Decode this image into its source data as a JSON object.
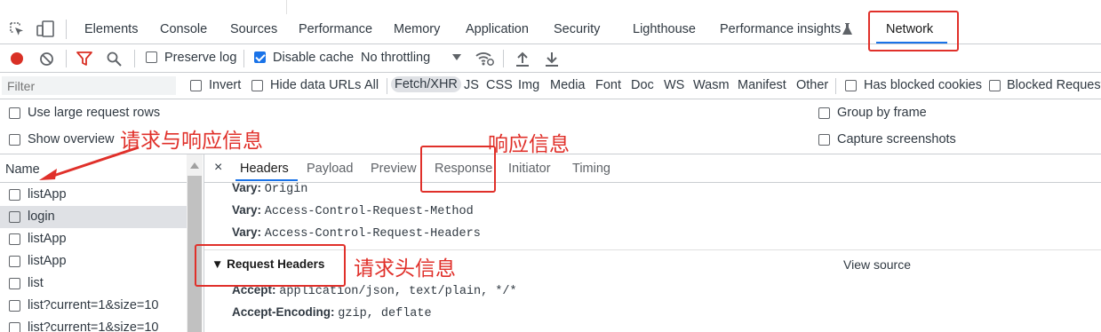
{
  "devtools": {
    "tabs": [
      {
        "label": "Elements"
      },
      {
        "label": "Console"
      },
      {
        "label": "Sources"
      },
      {
        "label": "Performance"
      },
      {
        "label": "Memory"
      },
      {
        "label": "Application"
      },
      {
        "label": "Security"
      },
      {
        "label": "Lighthouse"
      },
      {
        "label": "Performance insights"
      },
      {
        "label": "Network",
        "selected": true
      }
    ],
    "toolbar": {
      "preserve_log": "Preserve log",
      "preserve_log_checked": false,
      "disable_cache": "Disable cache",
      "disable_cache_checked": true,
      "throttling": "No throttling"
    },
    "filterbar": {
      "placeholder": "Filter",
      "invert": "Invert",
      "hide_data_urls": "Hide data URLs",
      "types": [
        "All",
        "Fetch/XHR",
        "JS",
        "CSS",
        "Img",
        "Media",
        "Font",
        "Doc",
        "WS",
        "Wasm",
        "Manifest",
        "Other"
      ],
      "selected_type": "Fetch/XHR",
      "has_blocked_cookies": "Has blocked cookies",
      "blocked_requests": "Blocked Requests"
    },
    "options": {
      "large_rows": "Use large request rows",
      "show_overview": "Show overview",
      "group_by_frame": "Group by frame",
      "capture_screenshots": "Capture screenshots"
    },
    "request_list": {
      "header": "Name",
      "items": [
        "listApp",
        "login",
        "listApp",
        "listApp",
        "list",
        "list?current=1&size=10",
        "list?current=1&size=10"
      ],
      "selected_index": 1
    },
    "detail": {
      "close": "×",
      "tabs": [
        "Headers",
        "Payload",
        "Preview",
        "Response",
        "Initiator",
        "Timing"
      ],
      "selected_tab": "Headers",
      "response_headers": [
        {
          "key": "Vary:",
          "value": "Origin"
        },
        {
          "key": "Vary:",
          "value": "Access-Control-Request-Method"
        },
        {
          "key": "Vary:",
          "value": "Access-Control-Request-Headers"
        }
      ],
      "request_headers_title": "▼ Request Headers",
      "view_source": "View source",
      "request_headers": [
        {
          "key": "Accept:",
          "value": "application/json, text/plain, */*"
        },
        {
          "key": "Accept-Encoding:",
          "value": "gzip, deflate"
        }
      ]
    }
  },
  "annotations": {
    "req_resp_info": "请求与响应信息",
    "response_info": "响应信息",
    "request_header_info": "请求头信息"
  },
  "colors": {
    "annotation_red": "#e0302a",
    "accent_blue": "#1a73e8",
    "record_red": "#d93025"
  }
}
